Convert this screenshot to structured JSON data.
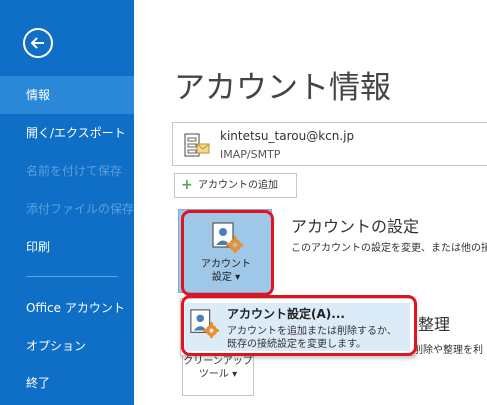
{
  "sidebar": {
    "items": [
      {
        "label": "情報"
      },
      {
        "label": "開く/エクスポート"
      },
      {
        "label": "名前を付けて保存"
      },
      {
        "label": "添付ファイルの保存"
      },
      {
        "label": "印刷"
      },
      {
        "label": "Office アカウント"
      },
      {
        "label": "オプション"
      },
      {
        "label": "終了"
      }
    ]
  },
  "main": {
    "title": "アカウント情報",
    "account": {
      "email": "kintetsu_tarou@kcn.jp",
      "type": "IMAP/SMTP"
    },
    "add_account_label": "アカウントの追加",
    "settings_button": {
      "line1": "アカウント",
      "line2": "設定 ▾"
    },
    "settings_section": {
      "title": "アカウントの設定",
      "description": "このアカウントの設定を変更、または他の接"
    },
    "cleanup_section": {
      "title": "整理",
      "description": "削除や整理を利"
    },
    "cleanup_button": {
      "line1": "クリーンアップ",
      "line2": "ツール ▾"
    }
  },
  "dropdown": {
    "item_title": "アカウント設定(A)...",
    "item_desc_line1": "アカウントを追加または削除するか、",
    "item_desc_line2": "既存の接続設定を変更します。"
  },
  "colors": {
    "sidebar_bg": "#0f6fc6",
    "sidebar_selected": "#2b88d8",
    "highlight_red": "#e0141e",
    "settings_button_bg": "#9fc7e8"
  },
  "icons": [
    "back-arrow-icon",
    "account-card-icon",
    "plus-icon",
    "account-settings-gear-icon"
  ]
}
